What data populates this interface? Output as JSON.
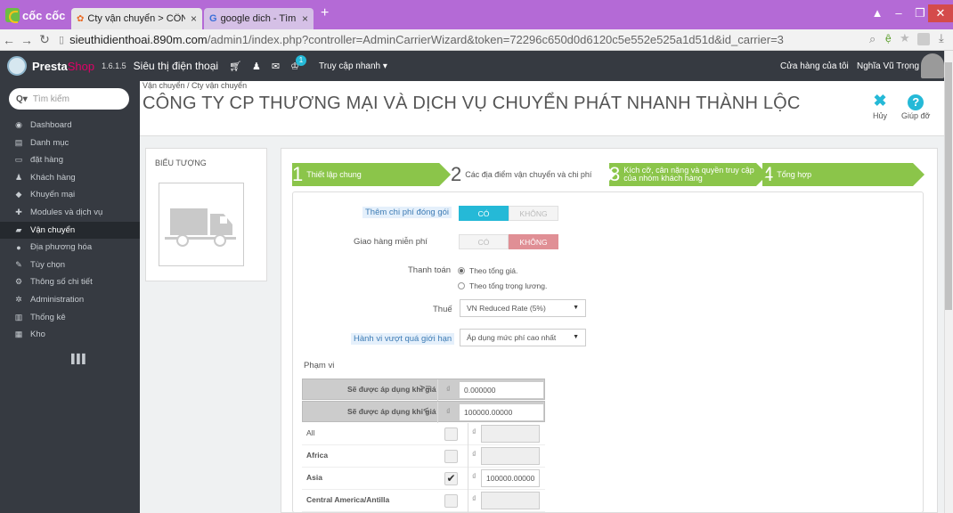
{
  "browser": {
    "brand": "cốc cốc",
    "tabs": [
      {
        "label": "Cty vận chuyển > CÔNG T",
        "close": "×"
      },
      {
        "label": "google dich - Tìm với Goo",
        "close": "×"
      }
    ],
    "new_tab": "+",
    "url_host": "sieuthidienthoai.890m.com",
    "url_path": "/admin1/index.php?controller=AdminCarrierWizard&token=72296c650d0d6120c5e552e525a1d51d&id_carrier=3"
  },
  "header": {
    "brand_presta": "Presta",
    "brand_shop": "Shop",
    "version": "1.6.1.5",
    "shop_name": "Siêu thị điện thoại",
    "notification_count": "1",
    "quick_access": "Truy cập nhanh ▾",
    "my_shop": "Cửa hàng của tôi",
    "employee": "Nghĩa Vũ Trọng ▾"
  },
  "sidebar": {
    "search_placeholder": "Tìm kiếm",
    "search_prefix": "Q▾",
    "items": [
      {
        "label": "Dashboard",
        "icon": "dashboard-icon",
        "glyph": "◉"
      },
      {
        "label": "Danh mục",
        "icon": "book-icon",
        "glyph": "▤"
      },
      {
        "label": "đặt hàng",
        "icon": "credit-card-icon",
        "glyph": "▭"
      },
      {
        "label": "Khách hàng",
        "icon": "users-icon",
        "glyph": "♟"
      },
      {
        "label": "Khuyến mại",
        "icon": "tag-icon",
        "glyph": "◆"
      },
      {
        "label": "Modules và dịch vụ",
        "icon": "puzzle-icon",
        "glyph": "✚"
      },
      {
        "label": "Vận chuyển",
        "icon": "truck-icon",
        "glyph": "▰"
      },
      {
        "label": "Địa phương hóa",
        "icon": "globe-icon",
        "glyph": "●"
      },
      {
        "label": "Tùy chọn",
        "icon": "wrench-icon",
        "glyph": "✎"
      },
      {
        "label": "Thông số chi tiết",
        "icon": "cogs-icon",
        "glyph": "⚙"
      },
      {
        "label": "Administration",
        "icon": "gear-icon",
        "glyph": "✲"
      },
      {
        "label": "Thống kê",
        "icon": "bar-chart-icon",
        "glyph": "▥"
      },
      {
        "label": "Kho",
        "icon": "stock-icon",
        "glyph": "▦"
      }
    ],
    "active_index": 6
  },
  "page": {
    "breadcrumb": "Vận chuyển  /  Cty vận chuyển",
    "title": "CÔNG TY CP THƯƠNG MẠI VÀ DỊCH VỤ CHUYỂN PHÁT NHANH THÀNH LỘC",
    "cancel_label": "Hủy",
    "help_label": "Giúp đỡ"
  },
  "logo_panel": {
    "heading": "BIỂU TƯỢNG"
  },
  "wizard": {
    "steps": [
      {
        "num": "1",
        "label": "Thiết lập chung"
      },
      {
        "num": "2",
        "label": "Các địa điểm vận chuyển và chi phí"
      },
      {
        "num": "3",
        "label": "Kích cỡ, cân nặng và quyền truy cập của nhóm khách hàng"
      },
      {
        "num": "4",
        "label": "Tổng hợp"
      }
    ],
    "current_step": 2
  },
  "form": {
    "handling_label": "Thêm chi phí đóng gói",
    "handling_yes": "CÓ",
    "handling_no": "KHÔNG",
    "free_label": "Giao hàng miễn phí",
    "free_yes": "CÓ",
    "free_no": "KHÔNG",
    "billing_label": "Thanh toán",
    "billing_opt1": "Theo tổng giá.",
    "billing_opt2": "Theo tổng trọng lương.",
    "tax_label": "Thuế",
    "tax_value": "VN Reduced Rate (5%)",
    "oor_label": "Hành vi vượt quá giới hạn",
    "oor_value": "Áp dụng mức phí cao nhất"
  },
  "ranges": {
    "heading": "Phạm vi",
    "currency": "₫",
    "cond_label": "Sẽ được áp dụng khi giá",
    "cond1_op": ">=",
    "cond1_value": "0.000000",
    "cond2_op": "<",
    "cond2_value": "100000.00000",
    "zones": [
      {
        "name": "All",
        "bold": false,
        "checked": false,
        "value": ""
      },
      {
        "name": "Africa",
        "bold": true,
        "checked": false,
        "value": ""
      },
      {
        "name": "Asia",
        "bold": true,
        "checked": true,
        "value": "100000.00000"
      },
      {
        "name": "Central America/Antilla",
        "bold": true,
        "checked": false,
        "value": ""
      }
    ]
  }
}
